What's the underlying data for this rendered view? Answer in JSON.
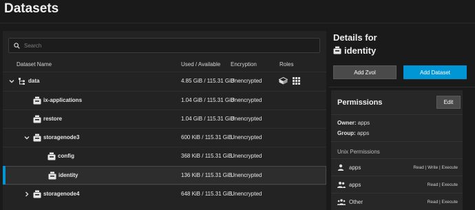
{
  "page": {
    "title": "Datasets"
  },
  "search": {
    "placeholder": "Search"
  },
  "table": {
    "columns": {
      "name": "Dataset Name",
      "used": "Used / Available",
      "encryption": "Encryption",
      "roles": "Roles"
    },
    "rows": [
      {
        "name": "data",
        "used": "4.85 GiB / 115.31 GiB",
        "encryption": "Unencrypted",
        "expand": "chevron-down",
        "icon": "pool-icon",
        "selected": false
      },
      {
        "name": "ix-applications",
        "used": "1.04 GiB / 115.31 GiB",
        "encryption": "Unencrypted",
        "expand": "",
        "icon": "dataset-icon",
        "selected": false
      },
      {
        "name": "restore",
        "used": "1.04 GiB / 115.31 GiB",
        "encryption": "Unencrypted",
        "expand": "",
        "icon": "dataset-icon",
        "selected": false
      },
      {
        "name": "storagenode3",
        "used": "600 KiB / 115.31 GiB",
        "encryption": "Unencrypted",
        "expand": "chevron-down",
        "icon": "dataset-icon",
        "selected": false
      },
      {
        "name": "config",
        "used": "368 KiB / 115.31 GiB",
        "encryption": "Unencrypted",
        "expand": "",
        "icon": "dataset-icon",
        "selected": false
      },
      {
        "name": "identity",
        "used": "136 KiB / 115.31 GiB",
        "encryption": "Unencrypted",
        "expand": "",
        "icon": "dataset-icon",
        "selected": true
      },
      {
        "name": "storagenode4",
        "used": "648 KiB / 115.31 GiB",
        "encryption": "Unencrypted",
        "expand": "chevron-right",
        "icon": "dataset-icon",
        "selected": false
      }
    ]
  },
  "details": {
    "label": "Details for",
    "name": "identity",
    "add_zvol": "Add Zvol",
    "add_dataset": "Add Dataset"
  },
  "permissions": {
    "title": "Permissions",
    "edit": "Edit",
    "owner_label": "Owner:",
    "owner": "apps",
    "group_label": "Group:",
    "group": "apps",
    "unix_label": "Unix Permissions",
    "entries": [
      {
        "icon": "user-icon",
        "name": "apps",
        "value": "Read | Write | Execute"
      },
      {
        "icon": "group-icon",
        "name": "apps",
        "value": "Read | Execute"
      },
      {
        "icon": "others-icon",
        "name": "Other",
        "value": "Read | Execute"
      }
    ]
  },
  "colors": {
    "accent": "#0095d5",
    "background": "#1a1a1a",
    "panel": "#232323"
  }
}
